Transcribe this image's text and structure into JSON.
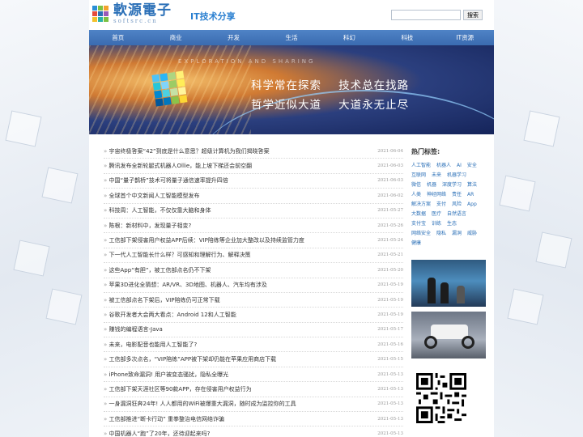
{
  "site": {
    "name_cn": "軟源電子",
    "name_en": "softsrc.cn",
    "tagline": "IT技术分享",
    "search_button": "搜索",
    "search_placeholder": ""
  },
  "nav": [
    "首页",
    "商业",
    "开发",
    "生活",
    "科幻",
    "科技",
    "IT资源"
  ],
  "banner": {
    "subtitle": "EXPLORATION AND SHARING",
    "slogan_line1": "科学常在探索    技术总在找路",
    "slogan_line2": "哲学近似大道    大道永无止尽"
  },
  "news": [
    {
      "title": "宇宙终极答案“42”到底是什么意思？超级计算机为我们揭晓答案",
      "date": "2021-06-04"
    },
    {
      "title": "腾讯发布全新轮腿式机器人Ollie，能上坡下梯还会前空翻",
      "date": "2021-06-03"
    },
    {
      "title": "中国“量子鹊桥”技术可将量子通信速率提升四倍",
      "date": "2021-06-03"
    },
    {
      "title": "全球首个中文新闻人工智能模型发布",
      "date": "2021-06-02"
    },
    {
      "title": "科技周：人工智能，不仅仅靠大脑和身体",
      "date": "2021-05-27"
    },
    {
      "title": "陈根：新材料中，发现量子相变?",
      "date": "2021-05-26"
    },
    {
      "title": "工信部下架侵害用户权益APP后续：VIP陪练等企业加大整改以及持续监管力度",
      "date": "2021-05-24"
    },
    {
      "title": "下一代人工智能长什么样？可感知和理解行为、解释决策",
      "date": "2021-05-21"
    },
    {
      "title": "这些App“有胆”，被工信部点名仍不下架",
      "date": "2021-05-20"
    },
    {
      "title": "苹果3D进化全猜想：AR/VR、3D地图、机器人、汽车均有涉及",
      "date": "2021-05-19"
    },
    {
      "title": "被工信部点名下架后，VIP陪练仍可正常下载",
      "date": "2021-05-19"
    },
    {
      "title": "谷歌开发者大会两大看点：Android 12和人工智能",
      "date": "2021-05-19"
    },
    {
      "title": "赚钱的编程语言-Java",
      "date": "2021-05-17"
    },
    {
      "title": "未来，电影配音也能用人工智能了?",
      "date": "2021-05-16"
    },
    {
      "title": "工信部多次点名，“VIP陪练”APP被下架却仍能在苹果应用商店下载",
      "date": "2021-05-15"
    },
    {
      "title": "iPhone致命漏洞! 用户被变态骚扰，隐私全曝光",
      "date": "2021-05-13"
    },
    {
      "title": "工信部下架天涯社区等90款APP，存在侵害用户权益行为",
      "date": "2021-05-13"
    },
    {
      "title": "一身漏洞狂奔24年! 人人都用的WiFi被爆重大漏洞，随时成为监控你的工具",
      "date": "2021-05-13"
    },
    {
      "title": "工信部推进“断卡行动” 重拳整治电信网络诈骗",
      "date": "2021-05-13"
    },
    {
      "title": "中国机器人“跑”了20年，还待迎起来吗?",
      "date": "2021-05-13"
    }
  ],
  "sidebar": {
    "title": "热门标签:",
    "tags": [
      "人工智能",
      "机器人",
      "AI",
      "安全",
      "互联网",
      "未来",
      "机器学习",
      "微信",
      "机器",
      "深度学习",
      "算法",
      "人类",
      "神经网络",
      "责任",
      "AR",
      "解决方案",
      "支付",
      "风险",
      "App",
      "大数据",
      "医疗",
      "自然语言",
      "支付宝",
      "训练",
      "生态",
      "网络安全",
      "隐私",
      "漏洞",
      "威胁",
      "健康"
    ]
  },
  "colors": {
    "brand_blue": "#2a6fb7",
    "nav_blue": "#3a6bb0",
    "link_blue": "#2a6fb7"
  }
}
